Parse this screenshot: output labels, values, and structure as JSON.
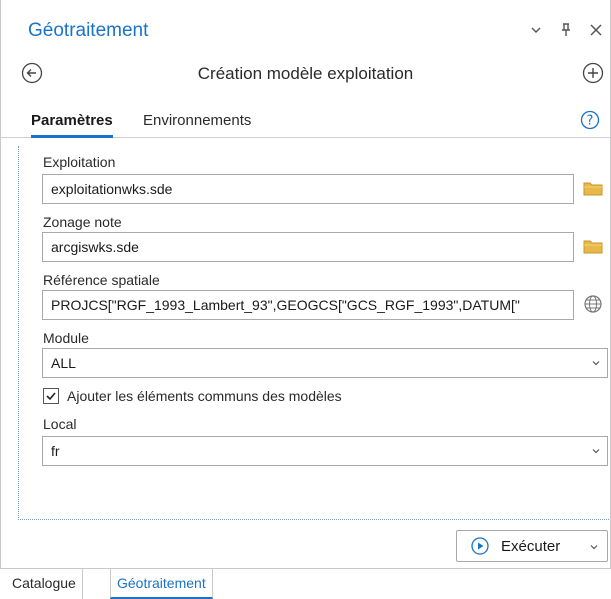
{
  "pane": {
    "title": "Géotraitement",
    "icons": [
      "chevron-down-icon",
      "pin-icon",
      "close-icon"
    ]
  },
  "toolbar": {
    "tool_title": "Création modèle exploitation"
  },
  "tabs": [
    {
      "label": "Paramètres",
      "active": true
    },
    {
      "label": "Environnements",
      "active": false
    }
  ],
  "params": {
    "exploitation": {
      "label": "Exploitation",
      "value": "exploitationwks.sde"
    },
    "zonage": {
      "label": "Zonage note",
      "value": "arcgiswks.sde"
    },
    "reference": {
      "label": "Référence spatiale",
      "value": "PROJCS[\"RGF_1993_Lambert_93\",GEOGCS[\"GCS_RGF_1993\",DATUM[\""
    },
    "module": {
      "label": "Module",
      "value": "ALL"
    },
    "checkbox": {
      "label": "Ajouter les éléments communs des modèles",
      "checked": true
    },
    "local": {
      "label": "Local",
      "value": "fr"
    }
  },
  "run": {
    "label": "Exécuter"
  },
  "bottom_tabs": [
    {
      "label": "Catalogue",
      "active": false
    },
    {
      "label": "Géotraitement",
      "active": true
    }
  ],
  "colors": {
    "accent": "#1a73c9",
    "folder": "#e8b84a"
  }
}
